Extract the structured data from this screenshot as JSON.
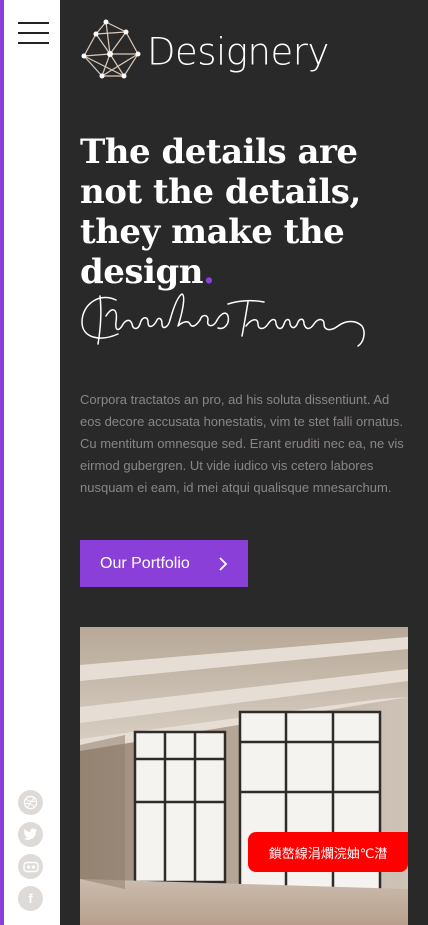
{
  "brand": {
    "name": "Designery",
    "accent_color": "#8a3fd8",
    "logo_icon": "geometric-network-icon"
  },
  "nav": {
    "menu_icon": "hamburger-menu-icon"
  },
  "hero": {
    "headline": "The details are not the details, they make the design",
    "headline_dot": ".",
    "signature_icon": "handwritten-signature",
    "signature_text": "Charles Eames",
    "body": "Corpora tractatos an pro, ad his soluta dissentiunt. Ad eos decore accusata honestatis, vim te stet falli ornatus. Cu mentitum omnesque sed. Erant eruditi nec ea, ne vis eirmod gubergren. Ut vide iudico vis cetero labores nusquam ei eam, id mei atqui qualisque mnesarchum.",
    "cta_label": "Our Portfolio",
    "cta_icon": "chevron-right-icon"
  },
  "socials": [
    {
      "name": "dribbble",
      "icon": "dribbble-icon"
    },
    {
      "name": "twitter",
      "icon": "twitter-icon"
    },
    {
      "name": "flickr",
      "icon": "flickr-icon"
    },
    {
      "name": "facebook",
      "icon": "facebook-icon",
      "glyph": "f"
    }
  ],
  "image": {
    "subject": "empty loft interior with large windows"
  },
  "chat_badge": {
    "label": "鎖嶅線涓爛浣妯℃澘"
  }
}
